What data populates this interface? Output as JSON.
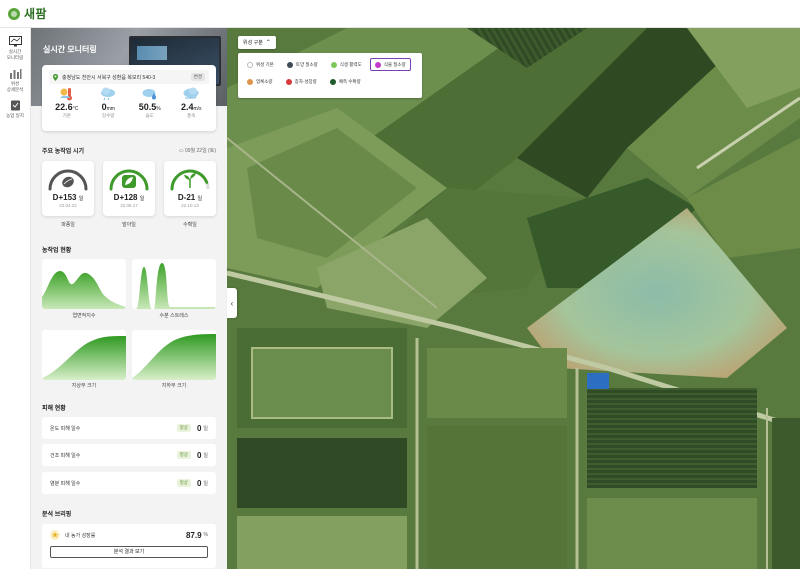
{
  "app": {
    "logo_text": "새팜",
    "brand_color": "#5aa53c"
  },
  "rail": {
    "items": [
      {
        "label": "실시간\n모니터링",
        "icon": "monitor-icon"
      },
      {
        "label": "위성\n상세분석",
        "icon": "bar-chart-icon"
      },
      {
        "label": "농업 일지",
        "icon": "journal-icon"
      }
    ]
  },
  "panel": {
    "title": "실시간 모니터링",
    "location": {
      "address": "충청남도 천안시 서북구 성환읍 복모리 540-3",
      "button": "변경"
    },
    "weather": [
      {
        "icon": "thermometer-sun-icon",
        "value": "22.6",
        "unit": "°C",
        "label": "기온"
      },
      {
        "icon": "cloud-rain-icon",
        "value": "0",
        "unit": "mm",
        "label": "강수량"
      },
      {
        "icon": "cloud-humidity-icon",
        "value": "50.5",
        "unit": "%",
        "label": "습도"
      },
      {
        "icon": "cloud-wind-icon",
        "value": "2.4",
        "unit": "m/s",
        "label": "풍속"
      }
    ],
    "stages": {
      "title": "주요 농작업 시기",
      "date": "09월 22일 (토)",
      "items": [
        {
          "icon": "seed-icon",
          "d": "D+153",
          "unit": "일",
          "date": "22.04.22",
          "name": "파종일",
          "progress": 1.0,
          "color": "#555555"
        },
        {
          "icon": "leaf-icon",
          "d": "D+128",
          "unit": "일",
          "date": "22.05.17",
          "name": "발아일",
          "progress": 1.0,
          "color": "#3e9a2a"
        },
        {
          "icon": "sprout-icon",
          "d": "D-21",
          "unit": "일",
          "date": "22.10.13",
          "name": "수확일",
          "progress": 0.88,
          "color": "#3e9a2a"
        }
      ]
    },
    "growth": {
      "title": "농작업 현황",
      "charts": [
        {
          "label": "엽면적지수"
        },
        {
          "label": "수분 스트레스"
        },
        {
          "label": "지상부 크기"
        },
        {
          "label": "지하부 크기"
        }
      ]
    },
    "damage": {
      "title": "피해 현황",
      "rows": [
        {
          "name": "온도 피해 일수",
          "badge": "정상",
          "value": "0",
          "unit": "일"
        },
        {
          "name": "건조 피해 일수",
          "badge": "정상",
          "value": "0",
          "unit": "일"
        },
        {
          "name": "염분 피해 일수",
          "badge": "정상",
          "value": "0",
          "unit": "일"
        }
      ]
    },
    "briefing": {
      "title": "분석 브리핑",
      "label": "내 농가 성장률",
      "value": "87.9",
      "unit": "%",
      "button": "분석 결과 보기"
    }
  },
  "map": {
    "layer_button": "위성 구분",
    "legend": [
      {
        "label": "위성 기본",
        "color": "#ffffff",
        "active": false
      },
      {
        "label": "토양 질소량",
        "color": "#3e4a57",
        "active": false
      },
      {
        "label": "식생 활력도",
        "color": "#7ec85a",
        "active": false
      },
      {
        "label": "식물 질소량",
        "color": "#c23ac9",
        "active": true
      },
      {
        "label": "엽록소량",
        "color": "#e0934a",
        "active": false
      },
      {
        "label": "종자·성장량",
        "color": "#d63a3a",
        "active": false
      },
      {
        "label": "예측 수확량",
        "color": "#1f5a2a",
        "active": false
      }
    ],
    "collapse_icon": "‹"
  }
}
